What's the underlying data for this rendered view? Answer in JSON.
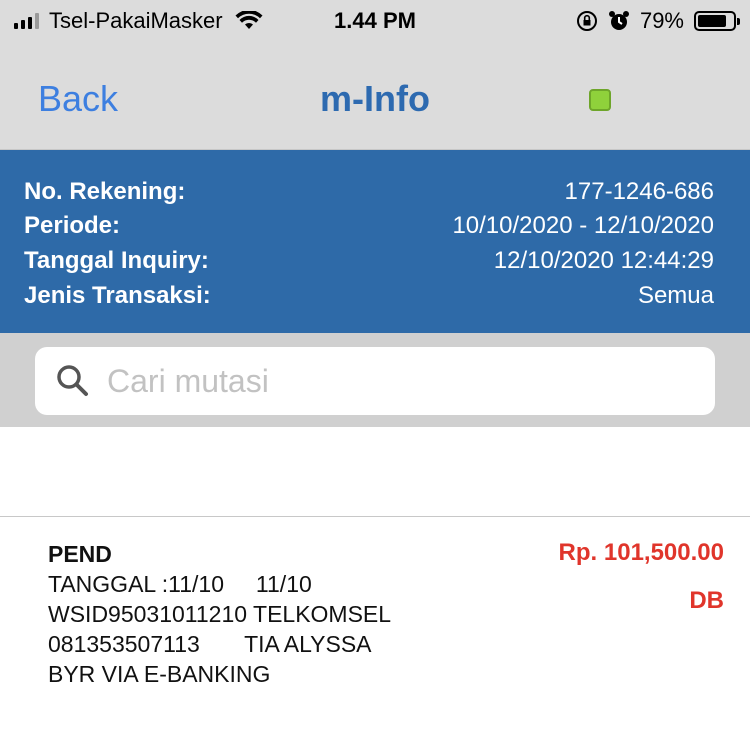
{
  "status_bar": {
    "carrier": "Tsel-PakaiMasker",
    "time": "1.44 PM",
    "battery": "79%",
    "signal_bars_active": 3,
    "signal_bars_total": 4,
    "icons": [
      "signal-icon",
      "wifi-icon",
      "orientation-lock-icon",
      "alarm-icon",
      "battery-icon"
    ]
  },
  "nav": {
    "back_label": "Back",
    "title": "m-Info",
    "indicator_color": "#8fd13b"
  },
  "info": {
    "rows": [
      {
        "label": "No. Rekening:",
        "value": "177-1246-686"
      },
      {
        "label": "Periode:",
        "value": "10/10/2020 - 12/10/2020"
      },
      {
        "label": "Tanggal Inquiry:",
        "value": "12/10/2020 12:44:29"
      },
      {
        "label": "Jenis Transaksi:",
        "value": "Semua"
      }
    ]
  },
  "search": {
    "placeholder": "Cari mutasi",
    "value": ""
  },
  "transactions": [
    {
      "lines": [
        "PEND",
        "TANGGAL :11/10     11/10",
        "WSID95031011210 TELKOMSEL",
        "081353507113       TIA ALYSSA",
        "BYR VIA E-BANKING"
      ],
      "amount": "Rp.  101,500.00",
      "type": "DB"
    }
  ],
  "colors": {
    "bar_bg": "#dcdcdc",
    "panel_bg": "#2e6aa8",
    "link_blue": "#3d7fe0",
    "title_blue": "#2d6ab0",
    "debit_red": "#e0352b"
  }
}
